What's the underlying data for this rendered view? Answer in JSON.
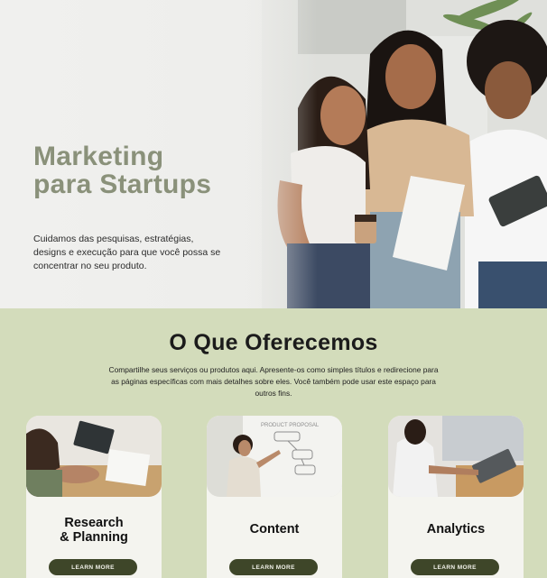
{
  "hero": {
    "title_line1": "Marketing",
    "title_line2": "para Startups",
    "description": "Cuidamos das pesquisas, estratégias, designs e execução para que você possa se concentrar no seu produto."
  },
  "offer": {
    "title": "O Que Oferecemos",
    "description": "Compartilhe seus serviços ou produtos aqui. Apresente-os como simples títulos e redirecione para as páginas específicas com mais detalhes sobre eles. Você também pode usar este espaço para outros fins.",
    "cards": [
      {
        "title_line1": "Research",
        "title_line2": "& Planning",
        "button": "LEARN MORE"
      },
      {
        "title_line1": "Content",
        "title_line2": "",
        "button": "LEARN MORE"
      },
      {
        "title_line1": "Analytics",
        "title_line2": "",
        "button": "LEARN MORE"
      }
    ]
  },
  "colors": {
    "hero_title": "#8a917a",
    "section_bg": "#d3dcbb",
    "button_bg": "#3e4629",
    "card_bg": "#f4f4ef"
  },
  "icons": {
    "hero": "hero-photo-three-women",
    "card1": "photo-research",
    "card2": "photo-whiteboard",
    "card3": "photo-laptop"
  }
}
